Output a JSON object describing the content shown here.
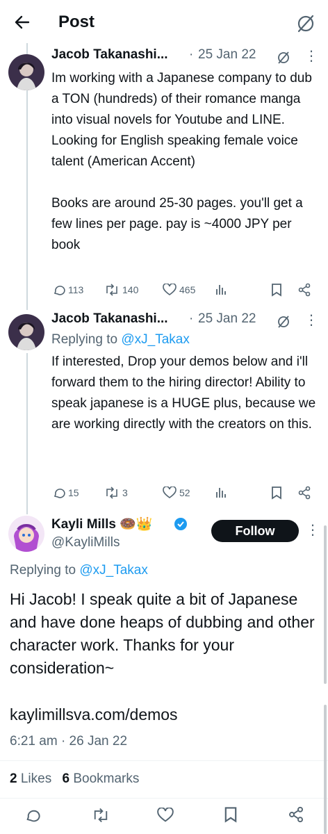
{
  "header": {
    "title": "Post"
  },
  "colors": {
    "accent": "#1d9bf0",
    "muted": "#536471",
    "text": "#0f1419",
    "follow_bg": "#0f1419"
  },
  "reply1": {
    "author": "Jacob Takanashi...",
    "dot": "·",
    "date": "25 Jan 22",
    "text": "Im working with a Japanese company to dub a TON (hundreds) of their romance manga into visual novels for Youtube and LINE. Looking for English speaking female voice talent (American Accent)\n\nBooks are around 25-30 pages. you'll get a few lines per page. pay is ~4000 JPY per book",
    "replies": "113",
    "reposts": "140",
    "likes": "465"
  },
  "reply2": {
    "author": "Jacob Takanashi...",
    "dot": "·",
    "date": "25 Jan 22",
    "replying_label": "Replying to",
    "replying_handle": "@xJ_Takax",
    "text": "If interested, Drop your demos below and i'll forward them to the hiring director! Ability to speak japanese is a HUGE plus, because we are working directly with the creators on this.",
    "replies": "15",
    "reposts": "3",
    "likes": "52"
  },
  "main": {
    "author": "Kayli Mills",
    "emoji": "🍩👑",
    "handle": "@KayliMills",
    "follow_label": "Follow",
    "replying_label": "Replying to",
    "replying_handle": "@xJ_Takax",
    "text": "Hi Jacob! I speak quite a bit of Japanese and have done heaps of dubbing and other character work. Thanks for your consideration~",
    "link": "kaylimillsva.com/demos",
    "time": "6:21 am",
    "dot": "·",
    "date": "26 Jan 22",
    "likes_count": "2",
    "likes_label": "Likes",
    "bookmarks_count": "6",
    "bookmarks_label": "Bookmarks"
  }
}
